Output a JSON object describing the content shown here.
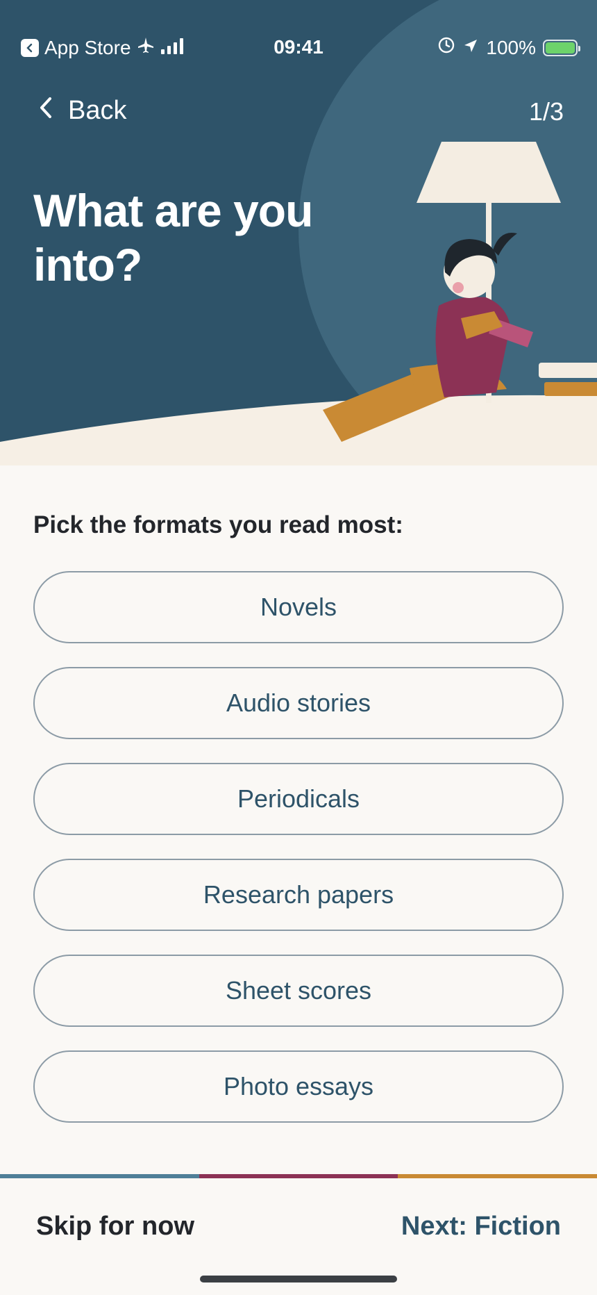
{
  "status_bar": {
    "back_app": "App Store",
    "time": "09:41",
    "battery": "100%",
    "battery_level": 1.0,
    "icons": [
      "app-store-back-icon",
      "airplane-icon",
      "signal-icon",
      "alarm-icon",
      "location-arrow-icon",
      "battery-icon"
    ]
  },
  "header": {
    "back_label": "Back",
    "step": "1/3",
    "title": "What are you into?"
  },
  "main": {
    "prompt": "Pick the formats you read most:",
    "options": [
      "Novels",
      "Audio stories",
      "Periodicals",
      "Research papers",
      "Sheet scores",
      "Photo essays"
    ]
  },
  "progress": {
    "segment_colors": [
      "#4f7f98",
      "#8c3255",
      "#c98a34"
    ]
  },
  "footer": {
    "skip_label": "Skip for now",
    "next_label": "Next: Fiction"
  },
  "colors": {
    "hero_bg": "#2e5369",
    "hero_circle": "#3f677d",
    "accent": "#2e5369",
    "page_bg": "#faf8f5"
  }
}
